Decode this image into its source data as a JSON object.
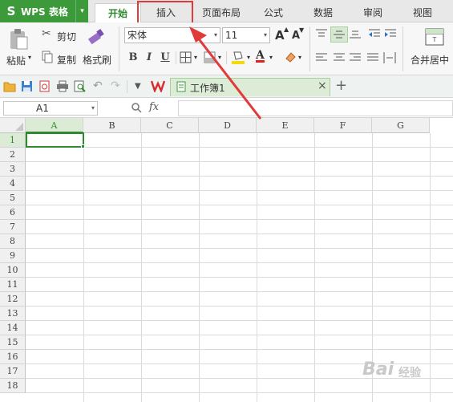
{
  "app": {
    "logo": "S",
    "name": "WPS 表格",
    "dropdown": "▾"
  },
  "tabs": [
    "开始",
    "插入",
    "页面布局",
    "公式",
    "数据",
    "审阅",
    "视图"
  ],
  "ribbon": {
    "paste": "粘贴",
    "cut": "剪切",
    "copy": "复制",
    "format_painter": "格式刷",
    "font_name": "宋体",
    "font_size": "11",
    "grow_font": "A",
    "shrink_font": "A",
    "bold": "B",
    "italic": "I",
    "underline": "U",
    "font_color": "A",
    "merge_center": "合并居中"
  },
  "document": {
    "tab_title": "工作簿1",
    "close": "×",
    "add": "+"
  },
  "formula_bar": {
    "cell_ref": "A1",
    "fx": "fx",
    "value": ""
  },
  "sheet": {
    "columns": [
      "A",
      "B",
      "C",
      "D",
      "E",
      "F",
      "G"
    ],
    "rows": [
      "1",
      "2",
      "3",
      "4",
      "5",
      "6",
      "7",
      "8",
      "9",
      "10",
      "11",
      "12",
      "13",
      "14",
      "15",
      "16",
      "17",
      "18"
    ],
    "selected_cell": "A1"
  },
  "watermark": {
    "text": "Bai",
    "suffix": "经验"
  },
  "colors": {
    "brand_green": "#3d9a3a",
    "active_tab_text": "#2f8a2f",
    "annotation_red": "#e03a3a"
  }
}
